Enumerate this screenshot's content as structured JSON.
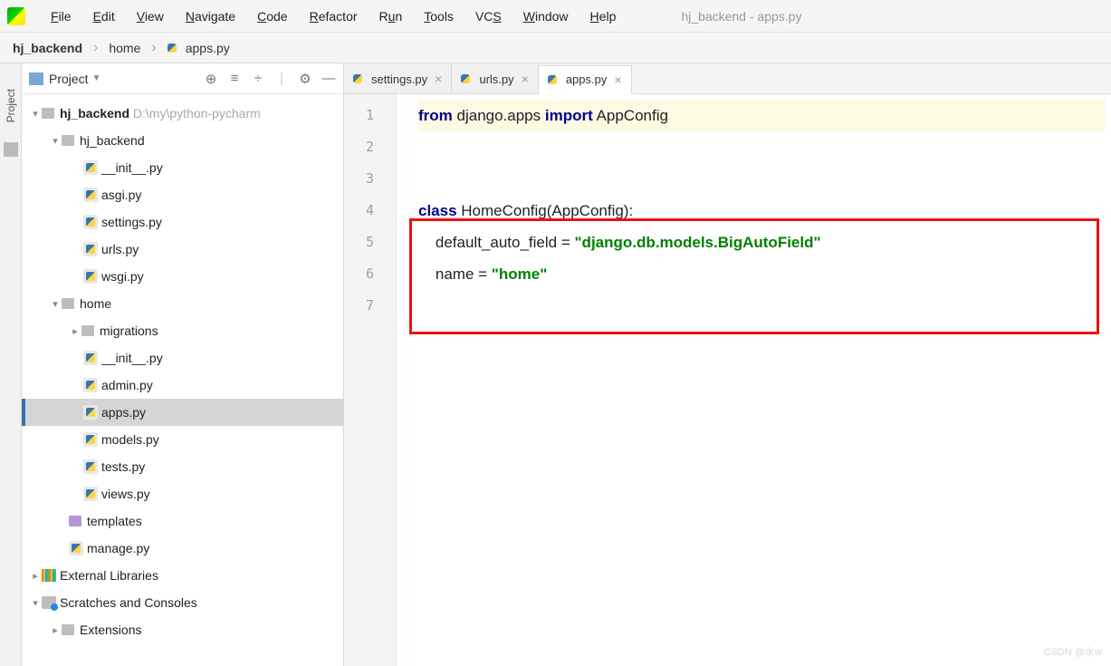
{
  "window": {
    "title": "hj_backend - apps.py"
  },
  "menu": [
    "File",
    "Edit",
    "View",
    "Navigate",
    "Code",
    "Refactor",
    "Run",
    "Tools",
    "VCS",
    "Window",
    "Help"
  ],
  "breadcrumb": {
    "root": "hj_backend",
    "mid": "home",
    "file": "apps.py"
  },
  "sidebar": {
    "title": "Project",
    "root": "hj_backend",
    "rootPath": "D:\\my\\python-pycharm",
    "innerPkg": "hj_backend",
    "innerFiles": [
      "__init__.py",
      "asgi.py",
      "settings.py",
      "urls.py",
      "wsgi.py"
    ],
    "homePkg": "home",
    "migrations": "migrations",
    "homeFiles": [
      "__init__.py",
      "admin.py",
      "apps.py",
      "models.py",
      "tests.py",
      "views.py"
    ],
    "templates": "templates",
    "manage": "manage.py",
    "extLib": "External Libraries",
    "scratches": "Scratches and Consoles",
    "extensions": "Extensions"
  },
  "tabs": [
    {
      "label": "settings.py",
      "active": false
    },
    {
      "label": "urls.py",
      "active": false
    },
    {
      "label": "apps.py",
      "active": true
    }
  ],
  "code": {
    "l1_kw1": "from",
    "l1_pkg": " django.apps ",
    "l1_kw2": "import",
    "l1_cls": " AppConfig",
    "l4_kw": "class",
    "l4_sig": " HomeConfig(AppConfig):",
    "l5_pre": "    default_auto_field = ",
    "l5_str": "\"django.db.models.BigAutoField\"",
    "l6_pre": "    name = ",
    "l6_str": "\"home\""
  },
  "watermark": "CSDN @水w"
}
